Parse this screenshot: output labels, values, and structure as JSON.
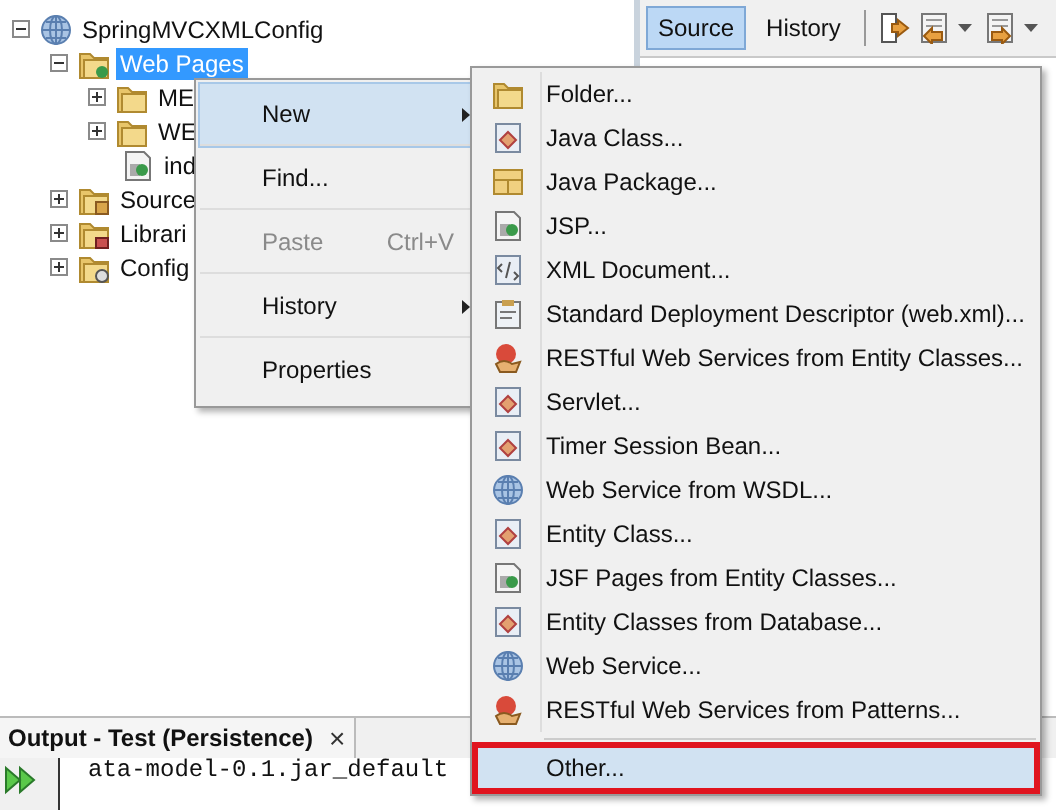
{
  "project_tree": {
    "root": {
      "label": "SpringMVCXMLConfig",
      "expanded": true,
      "selected": false,
      "kind": "globe",
      "children": [
        {
          "label": "Web Pages",
          "expanded": true,
          "selected": true,
          "kind": "webfolder",
          "children": [
            {
              "label": "ME",
              "expanded": false,
              "selected": false,
              "kind": "folder"
            },
            {
              "label": "WE",
              "expanded": false,
              "selected": false,
              "kind": "folder"
            },
            {
              "label": "ind",
              "selected": false,
              "kind": "page"
            }
          ]
        },
        {
          "label": "Source",
          "expanded": false,
          "selected": false,
          "kind": "srcfolder"
        },
        {
          "label": "Librari",
          "expanded": false,
          "selected": false,
          "kind": "libfolder"
        },
        {
          "label": "Config",
          "expanded": false,
          "selected": false,
          "kind": "cfgfolder"
        }
      ]
    }
  },
  "editor": {
    "tabs": [
      {
        "label": "Source",
        "selected": true
      },
      {
        "label": "History",
        "selected": false
      }
    ]
  },
  "context_menu": {
    "items": [
      {
        "label": "New",
        "selected": true,
        "disabled": false,
        "submenu": true
      },
      {
        "label": "Find...",
        "selected": false,
        "disabled": false,
        "submenu": false
      },
      {
        "label": "Paste",
        "shortcut": "Ctrl+V",
        "selected": false,
        "disabled": true,
        "submenu": false
      },
      {
        "label": "History",
        "selected": false,
        "disabled": false,
        "submenu": true
      },
      {
        "label": "Properties",
        "selected": false,
        "disabled": false,
        "submenu": false
      }
    ]
  },
  "submenu": {
    "sections": [
      {
        "items": [
          {
            "label": "Folder...",
            "kind": "folder",
            "selected": false
          },
          {
            "label": "Java Class...",
            "kind": "class",
            "selected": false
          },
          {
            "label": "Java Package...",
            "kind": "package",
            "selected": false
          },
          {
            "label": "JSP...",
            "kind": "page",
            "selected": false
          },
          {
            "label": "XML Document...",
            "kind": "xml",
            "selected": false
          },
          {
            "label": "Standard Deployment Descriptor (web.xml)...",
            "kind": "descriptor",
            "selected": false
          },
          {
            "label": "RESTful Web Services from Entity Classes...",
            "kind": "rest",
            "selected": false
          },
          {
            "label": "Servlet...",
            "kind": "class",
            "selected": false
          },
          {
            "label": "Timer Session Bean...",
            "kind": "class",
            "selected": false
          },
          {
            "label": "Web Service from WSDL...",
            "kind": "globe",
            "selected": false
          },
          {
            "label": "Entity Class...",
            "kind": "class",
            "selected": false
          },
          {
            "label": "JSF Pages from Entity Classes...",
            "kind": "page",
            "selected": false
          },
          {
            "label": "Entity Classes from Database...",
            "kind": "class",
            "selected": false
          },
          {
            "label": "Web Service...",
            "kind": "globe",
            "selected": false
          },
          {
            "label": "RESTful Web Services from Patterns...",
            "kind": "rest",
            "selected": false
          }
        ]
      },
      {
        "items": [
          {
            "label": "Other...",
            "kind": "none",
            "selected": true
          }
        ]
      }
    ]
  },
  "output": {
    "title": "Output - Test (Persistence)",
    "close": "×",
    "line": "ata-model-0.1.jar_default"
  }
}
